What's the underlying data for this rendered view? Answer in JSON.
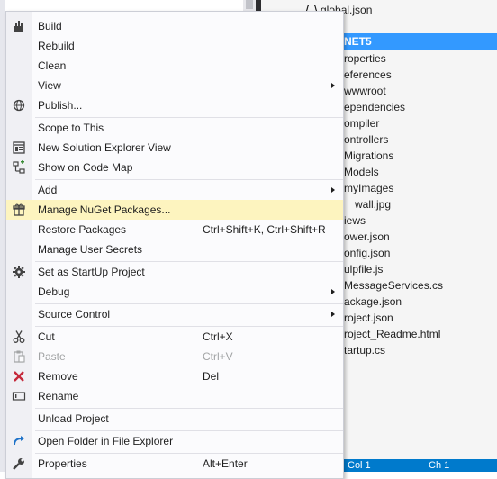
{
  "explorer": {
    "top_item": "global.json",
    "selected_project": "NET5",
    "items": [
      "roperties",
      "eferences",
      "wwwroot",
      "ependencies",
      "ompiler",
      "ontrollers",
      "Migrations",
      "Models",
      "myImages",
      "wall.jpg",
      "iews",
      "ower.json",
      "onfig.json",
      "ulpfile.js",
      "MessageServices.cs",
      "ackage.json",
      "roject.json",
      "roject_Readme.html",
      "tartup.cs"
    ]
  },
  "status": {
    "col": "Col 1",
    "ch": "Ch 1"
  },
  "menu": {
    "build": "Build",
    "rebuild": "Rebuild",
    "clean": "Clean",
    "view": "View",
    "publish": "Publish...",
    "scope_to_this": "Scope to This",
    "new_solution_explorer_view": "New Solution Explorer View",
    "show_on_code_map": "Show on Code Map",
    "add": "Add",
    "manage_nuget": "Manage NuGet Packages...",
    "restore_packages": "Restore Packages",
    "restore_packages_shortcut": "Ctrl+Shift+K, Ctrl+Shift+R",
    "manage_user_secrets": "Manage User Secrets",
    "set_startup": "Set as StartUp Project",
    "debug": "Debug",
    "source_control": "Source Control",
    "cut": "Cut",
    "cut_shortcut": "Ctrl+X",
    "paste": "Paste",
    "paste_shortcut": "Ctrl+V",
    "remove": "Remove",
    "remove_shortcut": "Del",
    "rename": "Rename",
    "unload_project": "Unload Project",
    "open_folder": "Open Folder in File Explorer",
    "properties": "Properties",
    "properties_shortcut": "Alt+Enter"
  },
  "colors": {
    "hover": "#fdf4bf",
    "selection": "#3399ff",
    "status_bar": "#007acc"
  }
}
